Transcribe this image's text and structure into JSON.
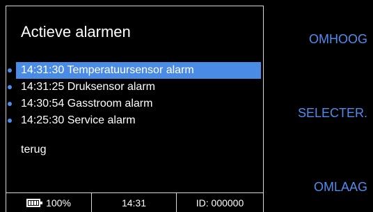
{
  "screen": {
    "title": "Actieve alarmen",
    "alarms": [
      {
        "label": "14:31:30 Temperatuursensor alarm",
        "selected": true
      },
      {
        "label": "14:31:25 Druksensor alarm",
        "selected": false
      },
      {
        "label": "14:30:54 Gasstroom alarm",
        "selected": false
      },
      {
        "label": "14:25:30 Service alarm",
        "selected": false
      }
    ],
    "back_label": "terug"
  },
  "status_bar": {
    "battery_icon": "battery-full-icon",
    "battery_level": "100%",
    "time": "14:31",
    "device_id": "ID: 000000"
  },
  "softkeys": {
    "up": "OMHOOG",
    "select": "SELECTER.",
    "down": "OMLAAG"
  },
  "colors": {
    "background": "#000000",
    "accent": "#4d8df0",
    "highlight": "#4a8be6",
    "border": "#d8d8d8",
    "text": "#ffffff"
  }
}
